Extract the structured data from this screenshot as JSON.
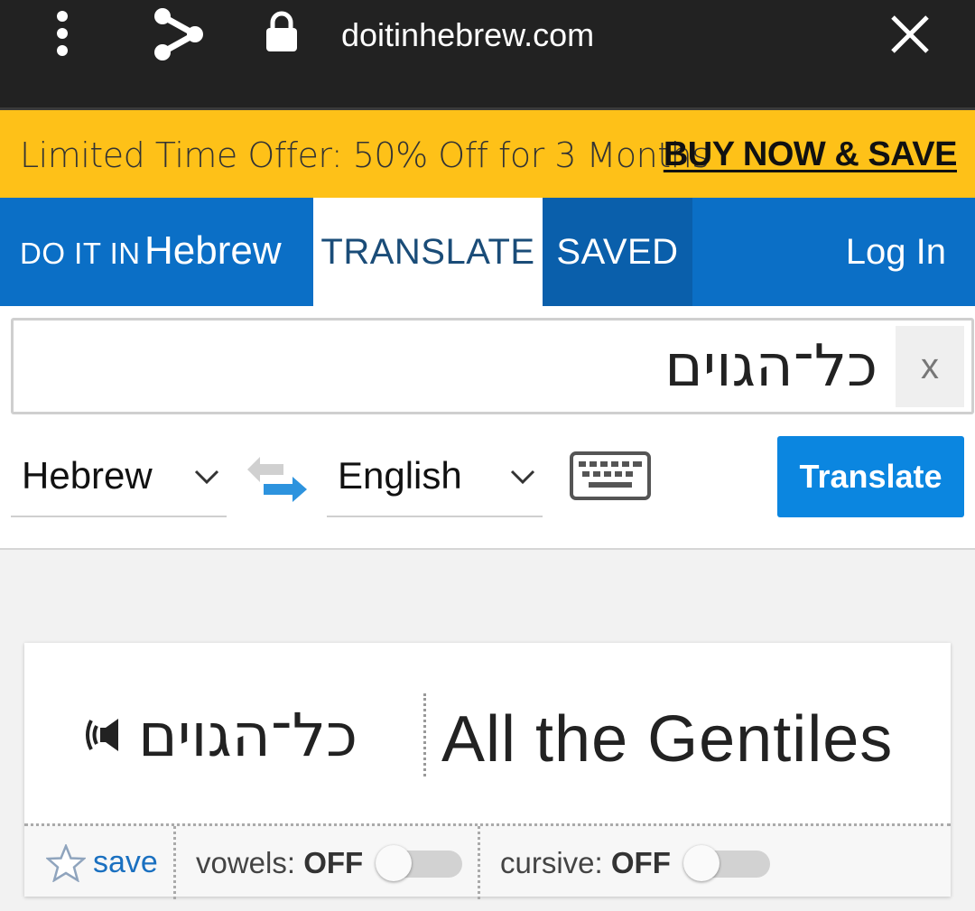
{
  "browser": {
    "url": "doitinhebrew.com"
  },
  "promo": {
    "text": "Limited Time Offer: 50% Off for 3 Months",
    "link": "BUY NOW & SAVE"
  },
  "nav": {
    "logo_small": "DO IT IN",
    "logo_big": "Hebrew",
    "tabs": [
      {
        "label": "TRANSLATE",
        "active": true
      },
      {
        "label": "SAVED",
        "active": false
      }
    ],
    "login": "Log In"
  },
  "search": {
    "value": "כל־הגוים",
    "clear_label": "x"
  },
  "languages": {
    "from": "Hebrew",
    "to": "English"
  },
  "translate_button": "Translate",
  "result": {
    "hebrew": "כל־הגוים",
    "english": "All the Gentiles",
    "save_label": "save",
    "vowels_label": "vowels:",
    "vowels_state": "OFF",
    "cursive_label": "cursive:",
    "cursive_state": "OFF"
  },
  "colors": {
    "browser_bar": "#222222",
    "promo_bg": "#fec118",
    "nav_bg": "#0b6fc6",
    "saved_tab_bg": "#0a5fab",
    "translate_button_bg": "#0b86e0",
    "link": "#1a70c0"
  },
  "icons": [
    "kebab-menu-icon",
    "share-icon",
    "lock-icon",
    "close-icon",
    "chevron-down-icon",
    "swap-arrows-icon",
    "keyboard-icon",
    "speaker-icon",
    "star-icon"
  ]
}
